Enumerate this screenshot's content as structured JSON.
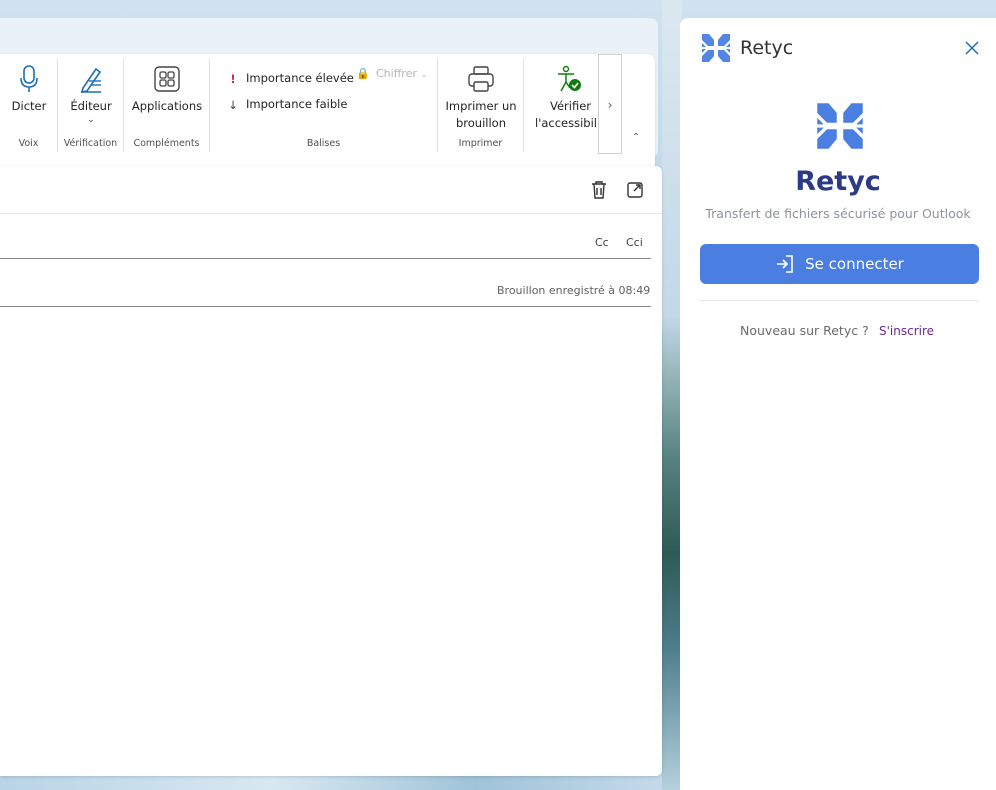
{
  "ribbon": {
    "groups": [
      {
        "label": "Voix"
      },
      {
        "label": "Vérification"
      },
      {
        "label": "Compléments"
      },
      {
        "label": "Balises"
      },
      {
        "label": "Imprimer"
      }
    ],
    "buttons": {
      "dicter": "Dicter",
      "editeur": "Éditeur",
      "applications": "Applications",
      "importance_high": "Importance élevée",
      "importance_low": "Importance faible",
      "chiffrer": "Chiffrer",
      "print_line1": "Imprimer un",
      "print_line2": "brouillon",
      "verify_line1": "Vérifier",
      "verify_line2": "l'accessibilité"
    }
  },
  "compose": {
    "cc": "Cc",
    "cci": "Cci",
    "draft_status": "Brouillon enregistré à 08:49"
  },
  "addin": {
    "header_title": "Retyc",
    "brand_name": "Retyc",
    "tagline": "Transfert de fichiers sécurisé pour Outlook",
    "connect_label": "Se connecter",
    "new_user_text": "Nouveau sur Retyc ?",
    "signup_label": "S'inscrire",
    "brand_color": "#2b3a86",
    "accent_color": "#4a7ee0"
  },
  "icons": [
    "microphone-icon",
    "editor-pen-icon",
    "apps-grid-icon",
    "exclamation-icon",
    "arrow-down-icon",
    "lock-icon",
    "printer-icon",
    "accessibility-icon",
    "trash-icon",
    "popout-icon",
    "retyc-logo-icon",
    "close-icon",
    "sign-in-icon"
  ]
}
